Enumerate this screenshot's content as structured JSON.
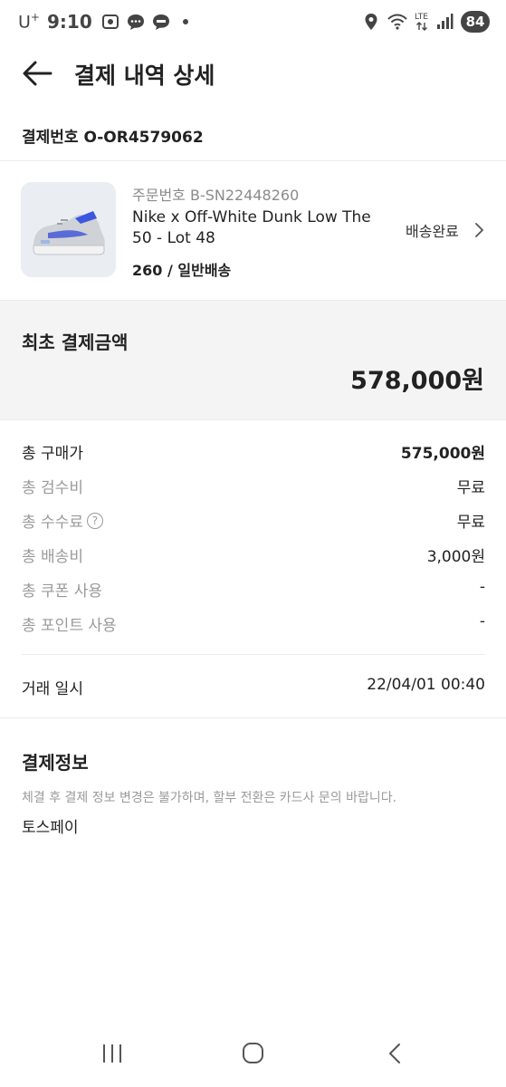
{
  "status_bar": {
    "carrier": "U",
    "carrier_sup": "+",
    "time": "9:10",
    "lte": "LTE",
    "battery": "84"
  },
  "header": {
    "title": "결제 내역 상세"
  },
  "payment": {
    "number_label": "결제번호 O-OR4579062"
  },
  "product": {
    "order_number": "주문번호 B-SN22448260",
    "name": "Nike x Off-White Dunk Low The 50 - Lot 48",
    "option": "260 / 일반배송",
    "delivery_status": "배송완료"
  },
  "total": {
    "label": "최초 결제금액",
    "amount": "578,000원"
  },
  "breakdown": [
    {
      "label": "총 구매가",
      "value": "575,000원"
    },
    {
      "label": "총 검수비",
      "value": "무료"
    },
    {
      "label": "총 수수료",
      "value": "무료",
      "help_icon": "question-circle-icon"
    },
    {
      "label": "총 배송비",
      "value": "3,000원"
    },
    {
      "label": "총 쿠폰 사용",
      "value": "-"
    },
    {
      "label": "총 포인트 사용",
      "value": "-"
    }
  ],
  "help_glyph": "?",
  "trade": {
    "label": "거래 일시",
    "value": "22/04/01 00:40"
  },
  "payment_info": {
    "title": "결제정보",
    "note": "체결 후 결제 정보 변경은 불가하며, 할부 전환은 카드사 문의 바랍니다.",
    "method": "토스페이"
  },
  "colors": {
    "text_primary": "#222222",
    "text_secondary": "#9a9a9a",
    "total_bg": "#f4f4f4"
  },
  "icons": [
    "back-arrow-icon",
    "chevron-right-icon",
    "question-circle-icon",
    "nav-recent-apps-icon",
    "nav-home-icon",
    "nav-back-icon",
    "location-icon",
    "wifi-icon",
    "signal-icon"
  ]
}
